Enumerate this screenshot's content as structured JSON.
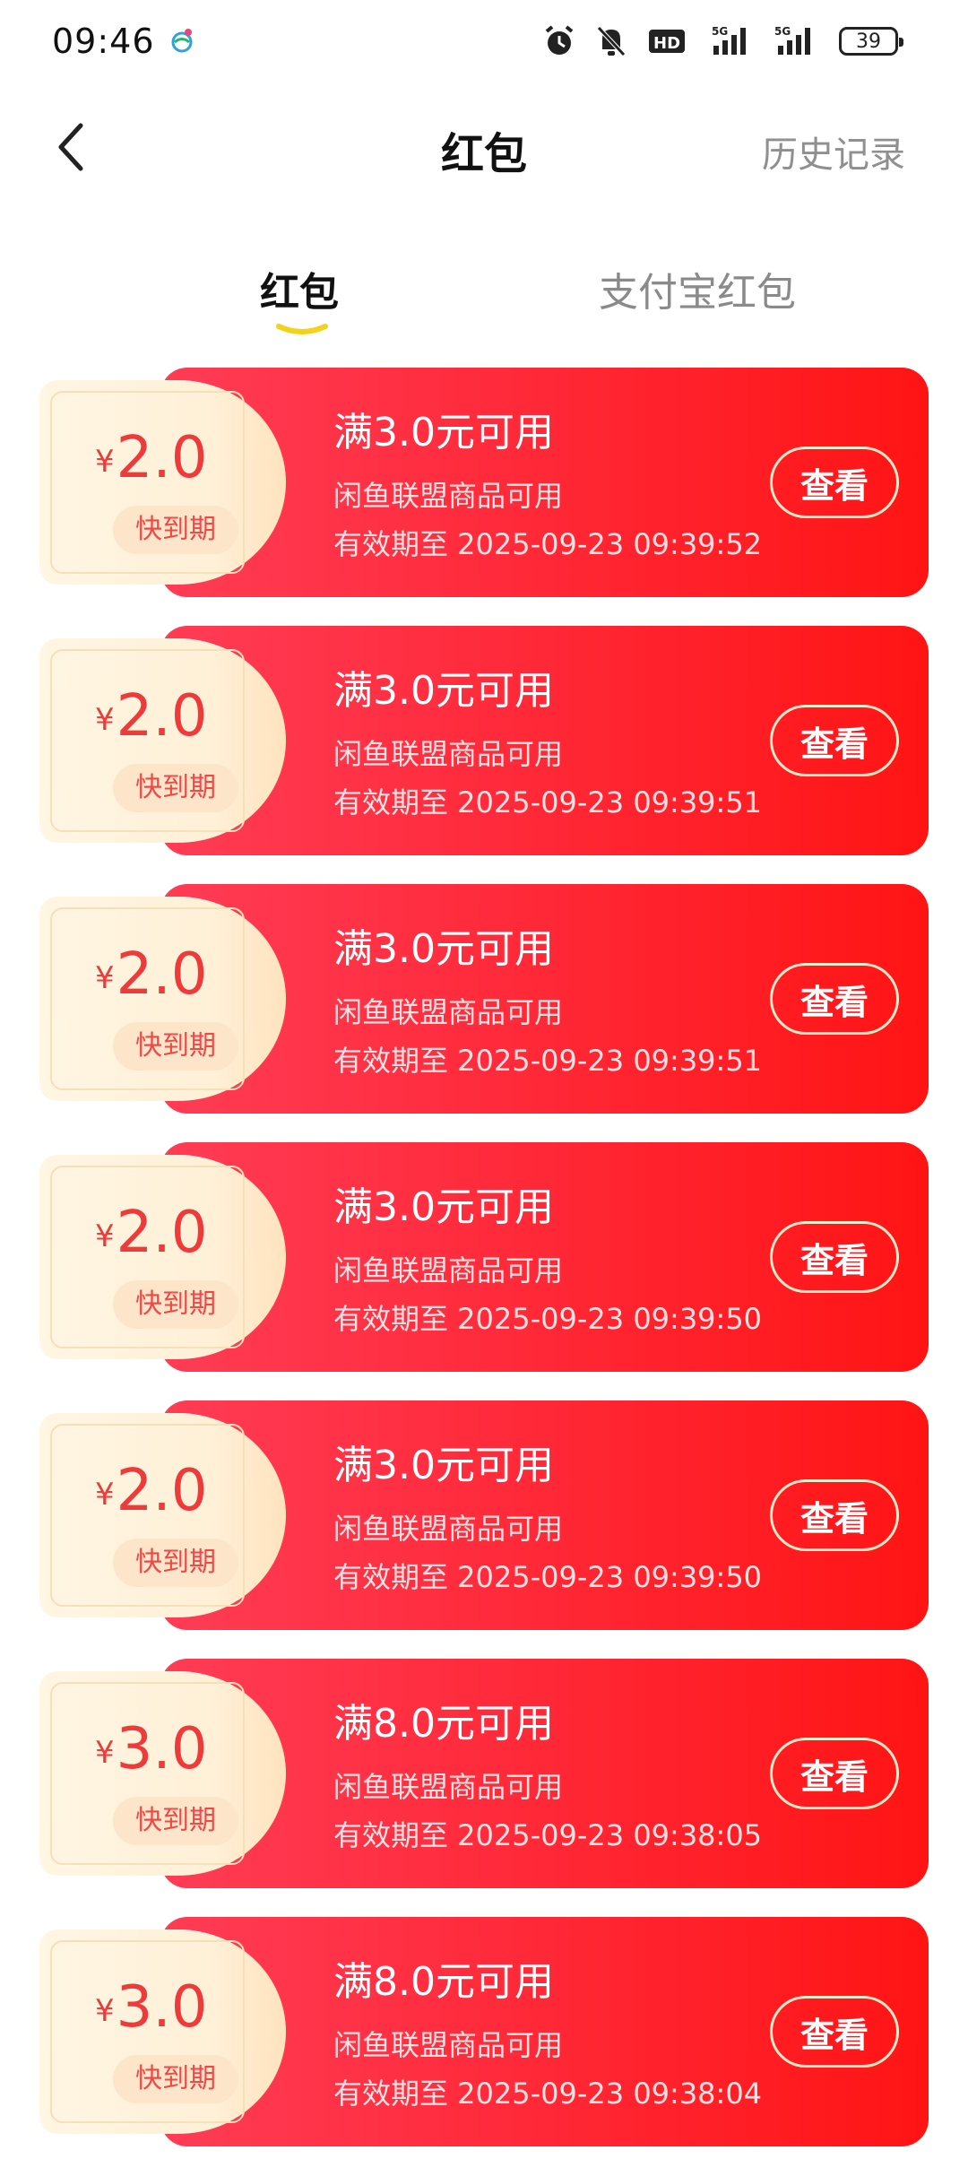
{
  "status_bar": {
    "time": "09:46",
    "battery": "39",
    "icons": [
      "app-icon",
      "alarm-icon",
      "mute-icon",
      "hd-icon",
      "signal-5g-icon",
      "signal-5g-icon"
    ]
  },
  "header": {
    "title": "红包",
    "history": "历史记录",
    "back_icon": "chevron-left-icon"
  },
  "tabs": [
    {
      "label": "红包",
      "active": true
    },
    {
      "label": "支付宝红包",
      "active": false
    }
  ],
  "colors": {
    "coupon_red": "#ff2a3a",
    "amount_red": "#ef3a3a",
    "tab_underline": "#f4d21a"
  },
  "coupons": [
    {
      "currency": "¥",
      "amount": "2.0",
      "badge": "快到期",
      "condition": "满3.0元可用",
      "scope": "闲鱼联盟商品可用",
      "validity": "有效期至 2025-09-23 09:39:52",
      "button": "查看"
    },
    {
      "currency": "¥",
      "amount": "2.0",
      "badge": "快到期",
      "condition": "满3.0元可用",
      "scope": "闲鱼联盟商品可用",
      "validity": "有效期至 2025-09-23 09:39:51",
      "button": "查看"
    },
    {
      "currency": "¥",
      "amount": "2.0",
      "badge": "快到期",
      "condition": "满3.0元可用",
      "scope": "闲鱼联盟商品可用",
      "validity": "有效期至 2025-09-23 09:39:51",
      "button": "查看"
    },
    {
      "currency": "¥",
      "amount": "2.0",
      "badge": "快到期",
      "condition": "满3.0元可用",
      "scope": "闲鱼联盟商品可用",
      "validity": "有效期至 2025-09-23 09:39:50",
      "button": "查看"
    },
    {
      "currency": "¥",
      "amount": "2.0",
      "badge": "快到期",
      "condition": "满3.0元可用",
      "scope": "闲鱼联盟商品可用",
      "validity": "有效期至 2025-09-23 09:39:50",
      "button": "查看"
    },
    {
      "currency": "¥",
      "amount": "3.0",
      "badge": "快到期",
      "condition": "满8.0元可用",
      "scope": "闲鱼联盟商品可用",
      "validity": "有效期至 2025-09-23 09:38:05",
      "button": "查看"
    },
    {
      "currency": "¥",
      "amount": "3.0",
      "badge": "快到期",
      "condition": "满8.0元可用",
      "scope": "闲鱼联盟商品可用",
      "validity": "有效期至 2025-09-23 09:38:04",
      "button": "查看"
    }
  ]
}
